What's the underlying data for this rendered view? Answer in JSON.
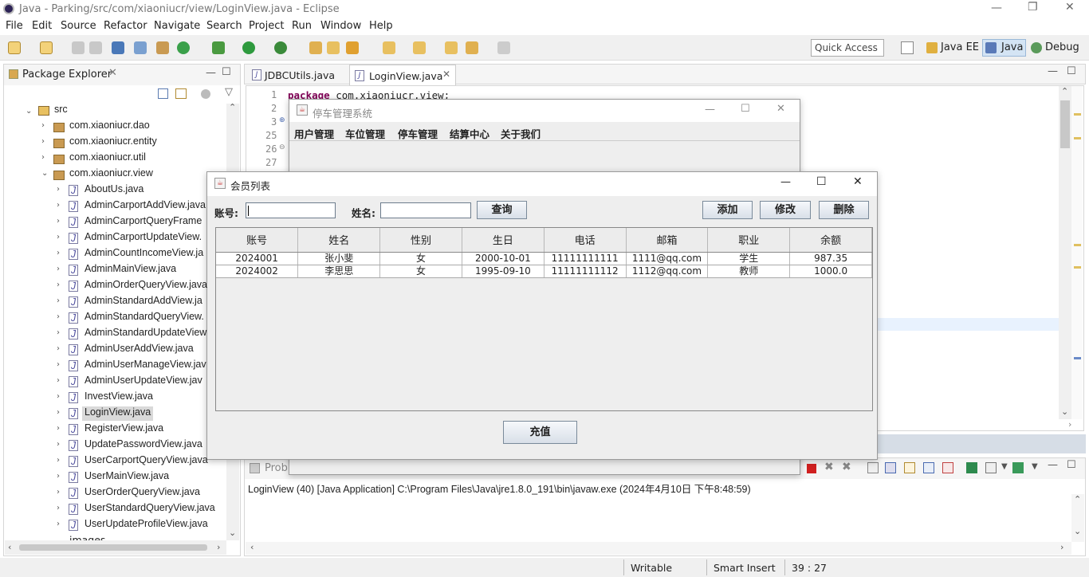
{
  "window": {
    "title": "Java - Parking/src/com/xiaoniucr/view/LoginView.java - Eclipse"
  },
  "menu": [
    "File",
    "Edit",
    "Source",
    "Refactor",
    "Navigate",
    "Search",
    "Project",
    "Run",
    "Window",
    "Help"
  ],
  "quick_access": "Quick Access",
  "perspectives": [
    "Java EE",
    "Java",
    "Debug"
  ],
  "package_explorer": {
    "title": "Package Explorer",
    "src": "src",
    "packages": [
      "com.xiaoniucr.dao",
      "com.xiaoniucr.entity",
      "com.xiaoniucr.util",
      "com.xiaoniucr.view"
    ],
    "files": [
      "AboutUs.java",
      "AdminCarportAddView.java",
      "AdminCarportQueryFrame",
      "AdminCarportUpdateView.",
      "AdminCountIncomeView.ja",
      "AdminMainView.java",
      "AdminOrderQueryView.java",
      "AdminStandardAddView.ja",
      "AdminStandardQueryView.",
      "AdminStandardUpdateView",
      "AdminUserAddView.java",
      "AdminUserManageView.jav",
      "AdminUserUpdateView.jav",
      "InvestView.java",
      "LoginView.java",
      "RegisterView.java",
      "UpdatePasswordView.java",
      "UserCarportQueryView.java",
      "UserMainView.java",
      "UserOrderQueryView.java",
      "UserStandardQueryView.java",
      "UserUpdateProfileView.java"
    ],
    "partial": "images"
  },
  "editor": {
    "tabs": [
      "JDBCUtils.java",
      "LoginView.java"
    ],
    "line_numbers": [
      "1",
      "2",
      "3",
      "25",
      "26",
      "27"
    ],
    "code_keyword": "package",
    "code_rest": " com.xiaoniucr.view;"
  },
  "bg_window": {
    "title": "停车管理系统",
    "menu": [
      "用户管理",
      "车位管理",
      "停车管理",
      "结算中心",
      "关于我们"
    ]
  },
  "dialog": {
    "title": "会员列表",
    "account_label": "账号:",
    "name_label": "姓名:",
    "query_button": "查询",
    "add_button": "添加",
    "edit_button": "修改",
    "delete_button": "删除",
    "recharge_button": "充值",
    "columns": [
      "账号",
      "姓名",
      "性别",
      "生日",
      "电话",
      "邮箱",
      "职业",
      "余额"
    ],
    "rows": [
      [
        "2024001",
        "张小斐",
        "女",
        "2000-10-01",
        "11111111111",
        "1111@qq.com",
        "学生",
        "987.35"
      ],
      [
        "2024002",
        "李思思",
        "女",
        "1995-09-10",
        "11111111112",
        "1112@qq.com",
        "教师",
        "1000.0"
      ]
    ]
  },
  "console": {
    "tab": "Prob",
    "text": "LoginView (40) [Java Application] C:\\Program Files\\Java\\jre1.8.0_191\\bin\\javaw.exe (2024年4月10日 下午8:48:59)"
  },
  "status": {
    "writable": "Writable",
    "insert": "Smart Insert",
    "position": "39 : 27"
  }
}
